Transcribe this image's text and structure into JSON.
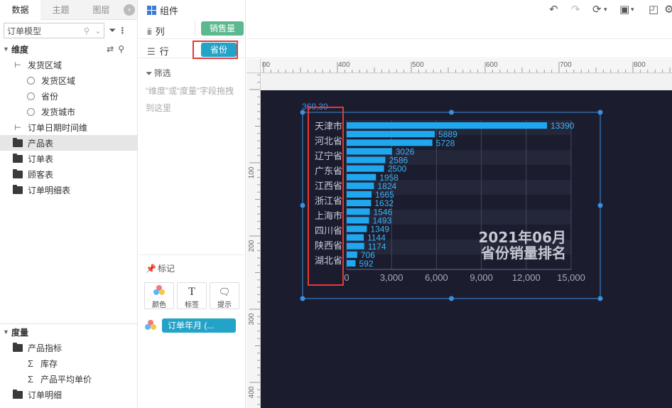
{
  "left_panel": {
    "tabs": [
      {
        "label": "数据",
        "active": true
      },
      {
        "label": "主题",
        "active": false
      },
      {
        "label": "图层",
        "active": false
      }
    ],
    "model_select": {
      "value": "订单模型"
    },
    "dimension_header": "维度",
    "dimensions": [
      {
        "label": "发货区域",
        "level": 1,
        "icon": "hierarchy-icon"
      },
      {
        "label": "发货区域",
        "level": 2,
        "icon": "globe-icon"
      },
      {
        "label": "省份",
        "level": 2,
        "icon": "globe-icon"
      },
      {
        "label": "发货城市",
        "level": 2,
        "icon": "globe-icon"
      },
      {
        "label": "订单日期时间维",
        "level": 1,
        "icon": "hierarchy-icon"
      },
      {
        "label": "产品表",
        "level": 1,
        "icon": "folder-icon",
        "selected": true
      },
      {
        "label": "订单表",
        "level": 1,
        "icon": "folder-icon"
      },
      {
        "label": "顾客表",
        "level": 1,
        "icon": "folder-icon"
      },
      {
        "label": "订单明细表",
        "level": 1,
        "icon": "folder-icon"
      }
    ],
    "measure_header": "度量",
    "measures": [
      {
        "label": "产品指标",
        "level": 1,
        "icon": "folder-icon"
      },
      {
        "label": "库存",
        "level": 2,
        "icon": "sigma-icon"
      },
      {
        "label": "产品平均单价",
        "level": 2,
        "icon": "sigma-icon"
      },
      {
        "label": "订单明细",
        "level": 1,
        "icon": "folder-icon"
      }
    ]
  },
  "middle_panel": {
    "component_title": "组件",
    "columns_label": "列",
    "rows_label": "行",
    "filter_title": "筛选",
    "filter_hint": "“维度”或“度量”字段拖拽到这里",
    "mark_title": "标记",
    "mark_buttons": [
      {
        "label": "颜色",
        "icon": "color-icon"
      },
      {
        "label": "标签",
        "icon": "text-icon"
      },
      {
        "label": "提示",
        "icon": "tooltip-icon"
      }
    ],
    "color_field": "订单年月 (..."
  },
  "shelves": {
    "column_pill": "销售量",
    "row_pill": "省份"
  },
  "canvas": {
    "ruler_top_labels": [
      "400",
      "500",
      "600",
      "700",
      "800"
    ],
    "ruler_left_labels": [
      "100",
      "200",
      "300",
      "400"
    ],
    "selection_readout": "369,30"
  },
  "colors": {
    "stage_bg": "#1b1c2e",
    "bar": "#1fa8f0",
    "accent_blue": "#24a3c8",
    "accent_green": "#5cb88e",
    "highlight_red": "#e53935"
  },
  "chart_data": {
    "type": "bar",
    "orientation": "horizontal",
    "title": "2021年06月\n省份销量排名",
    "category_labels": [
      "天津市",
      "河北省",
      "辽宁省",
      "广东省",
      "江西省",
      "浙江省",
      "上海市",
      "四川省",
      "陕西省",
      "湖北省"
    ],
    "values": [
      13390,
      5889,
      5728,
      3026,
      2586,
      2500,
      1958,
      1824,
      1665,
      1632,
      1546,
      1493,
      1349,
      1144,
      1174,
      706,
      592
    ],
    "xticks": [
      "0",
      "3,000",
      "6,000",
      "9,000",
      "12,000",
      "15,000"
    ],
    "xlim": [
      0,
      15000
    ],
    "grid": true
  }
}
